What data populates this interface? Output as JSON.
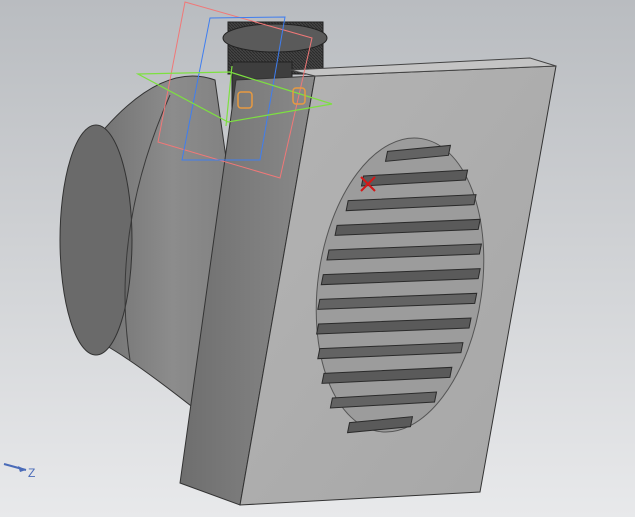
{
  "viewport": {
    "background_top": "#b9bcc0",
    "background_bottom": "#e8e9eb",
    "model_name": "exhaust-fan-with-grille"
  },
  "triad": {
    "axis_label": "Z",
    "axis_color": "#4a6bb8"
  },
  "grille": {
    "slat_count": 12
  },
  "sketch_planes": {
    "colors": {
      "front": "#f07878",
      "right": "#3f7ef0",
      "top": "#7de040",
      "handle": "#e89a40"
    }
  },
  "markers": {
    "origin_icon": "red-cross-marker-icon",
    "origin_color": "#d41818"
  }
}
